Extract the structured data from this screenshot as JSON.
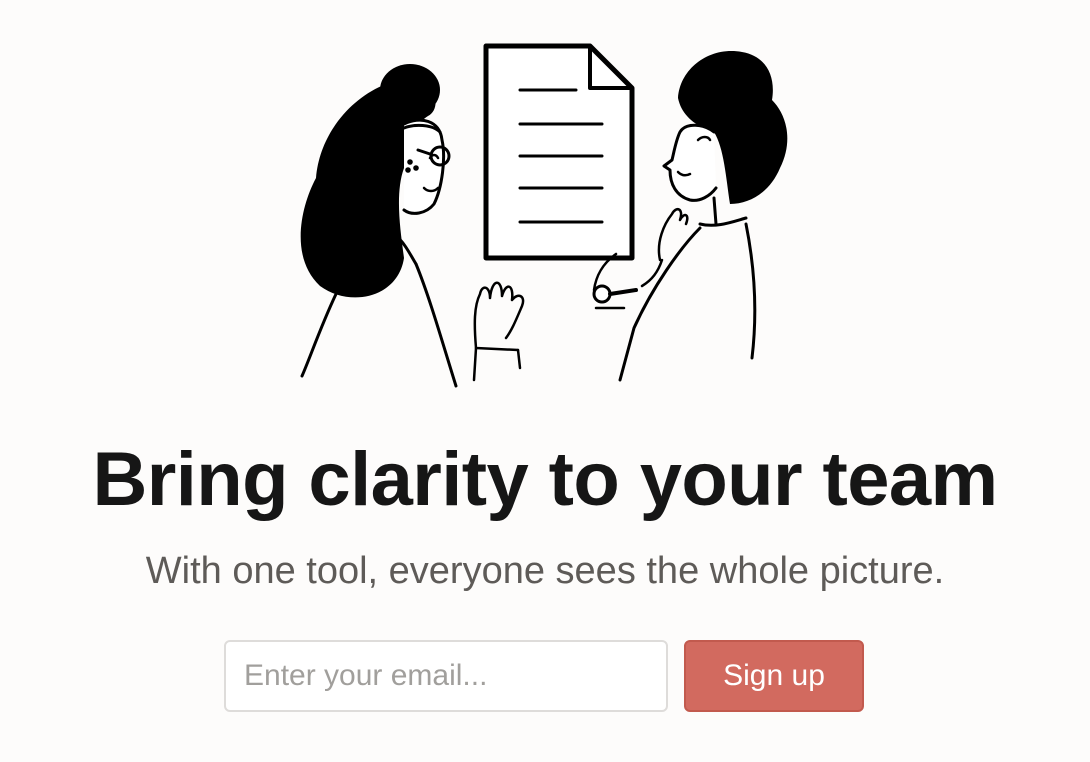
{
  "hero": {
    "headline": "Bring clarity to your team",
    "subheadline": "With one tool, everyone sees the whole picture."
  },
  "signup": {
    "email_placeholder": "Enter your email...",
    "email_value": "",
    "button_label": "Sign up"
  },
  "colors": {
    "background": "#fdfcfb",
    "headline": "#161616",
    "subheadline": "#5e5b58",
    "button": "#d26a5f",
    "button_text": "#ffffff"
  },
  "icons": {
    "illustration": "two-people-reviewing-document-illustration"
  }
}
